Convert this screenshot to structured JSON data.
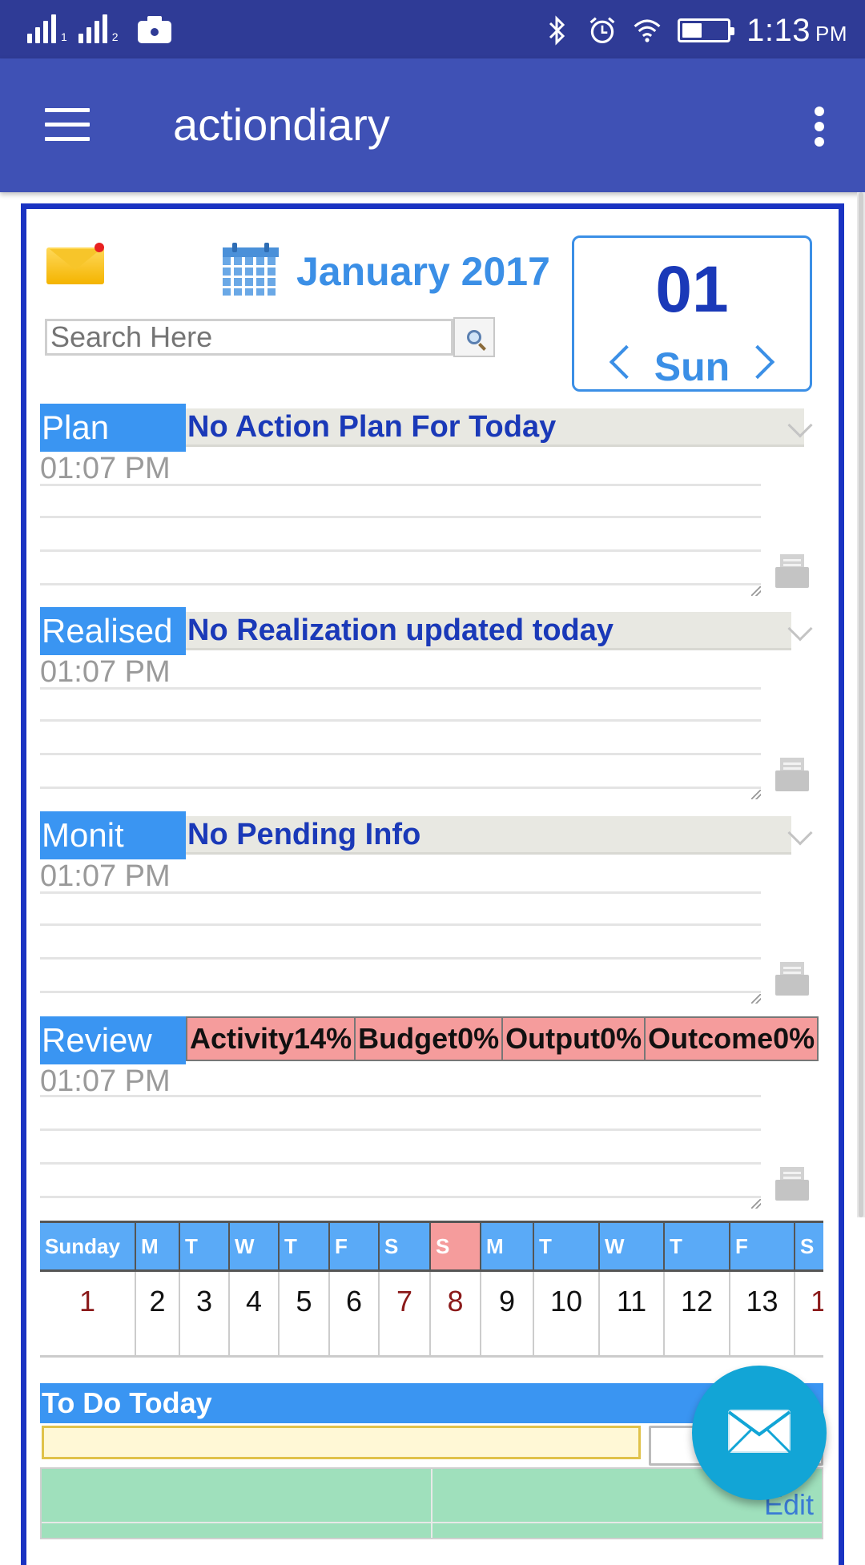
{
  "status_bar": {
    "sim1": "1",
    "sim2": "2",
    "time": "1:13",
    "ampm": "PM"
  },
  "app_bar": {
    "title": "actiondiary"
  },
  "header": {
    "month_title": "January 2017",
    "search_placeholder": "Search Here",
    "date_number": "01",
    "day_name": "Sun"
  },
  "sections": [
    {
      "label": "Plan",
      "status": "No Action Plan For Today",
      "time": "01:07 PM"
    },
    {
      "label": "Realised",
      "status": "No Realization updated today",
      "time": "01:07 PM"
    },
    {
      "label": "Monit",
      "status": "No Pending Info",
      "time": "01:07 PM"
    },
    {
      "label": "Review",
      "time": "01:07 PM",
      "metrics": [
        "Activity14%",
        "Budget0%",
        "Output0%",
        "Outcome0%"
      ]
    }
  ],
  "month_strip": {
    "headers": [
      "Sunday",
      "M",
      "T",
      "W",
      "T",
      "F",
      "S",
      "S",
      "M",
      "T",
      "W",
      "T",
      "F",
      "S"
    ],
    "days": [
      "1",
      "2",
      "3",
      "4",
      "5",
      "6",
      "7",
      "8",
      "9",
      "10",
      "11",
      "12",
      "13",
      "1"
    ]
  },
  "todo": {
    "title": "To Do Today",
    "edit_label": "Edit"
  },
  "colors": {
    "status_bar": "#2f3b96",
    "app_bar": "#3f51b5",
    "frame_border": "#1a33c2",
    "section_label": "#3a95f2",
    "status_text": "#1a39b8",
    "review_cells": "#f59c9c",
    "todo_rows": "#9fe0bc",
    "fab": "#12a5d6"
  },
  "icons": {
    "menu": "hamburger-icon",
    "more": "overflow-menu-icon",
    "mail": "mail-icon",
    "calendar": "calendar-icon",
    "search": "search-icon",
    "print": "print-icon",
    "expand": "chevron-down-icon",
    "fab": "envelope-icon"
  }
}
